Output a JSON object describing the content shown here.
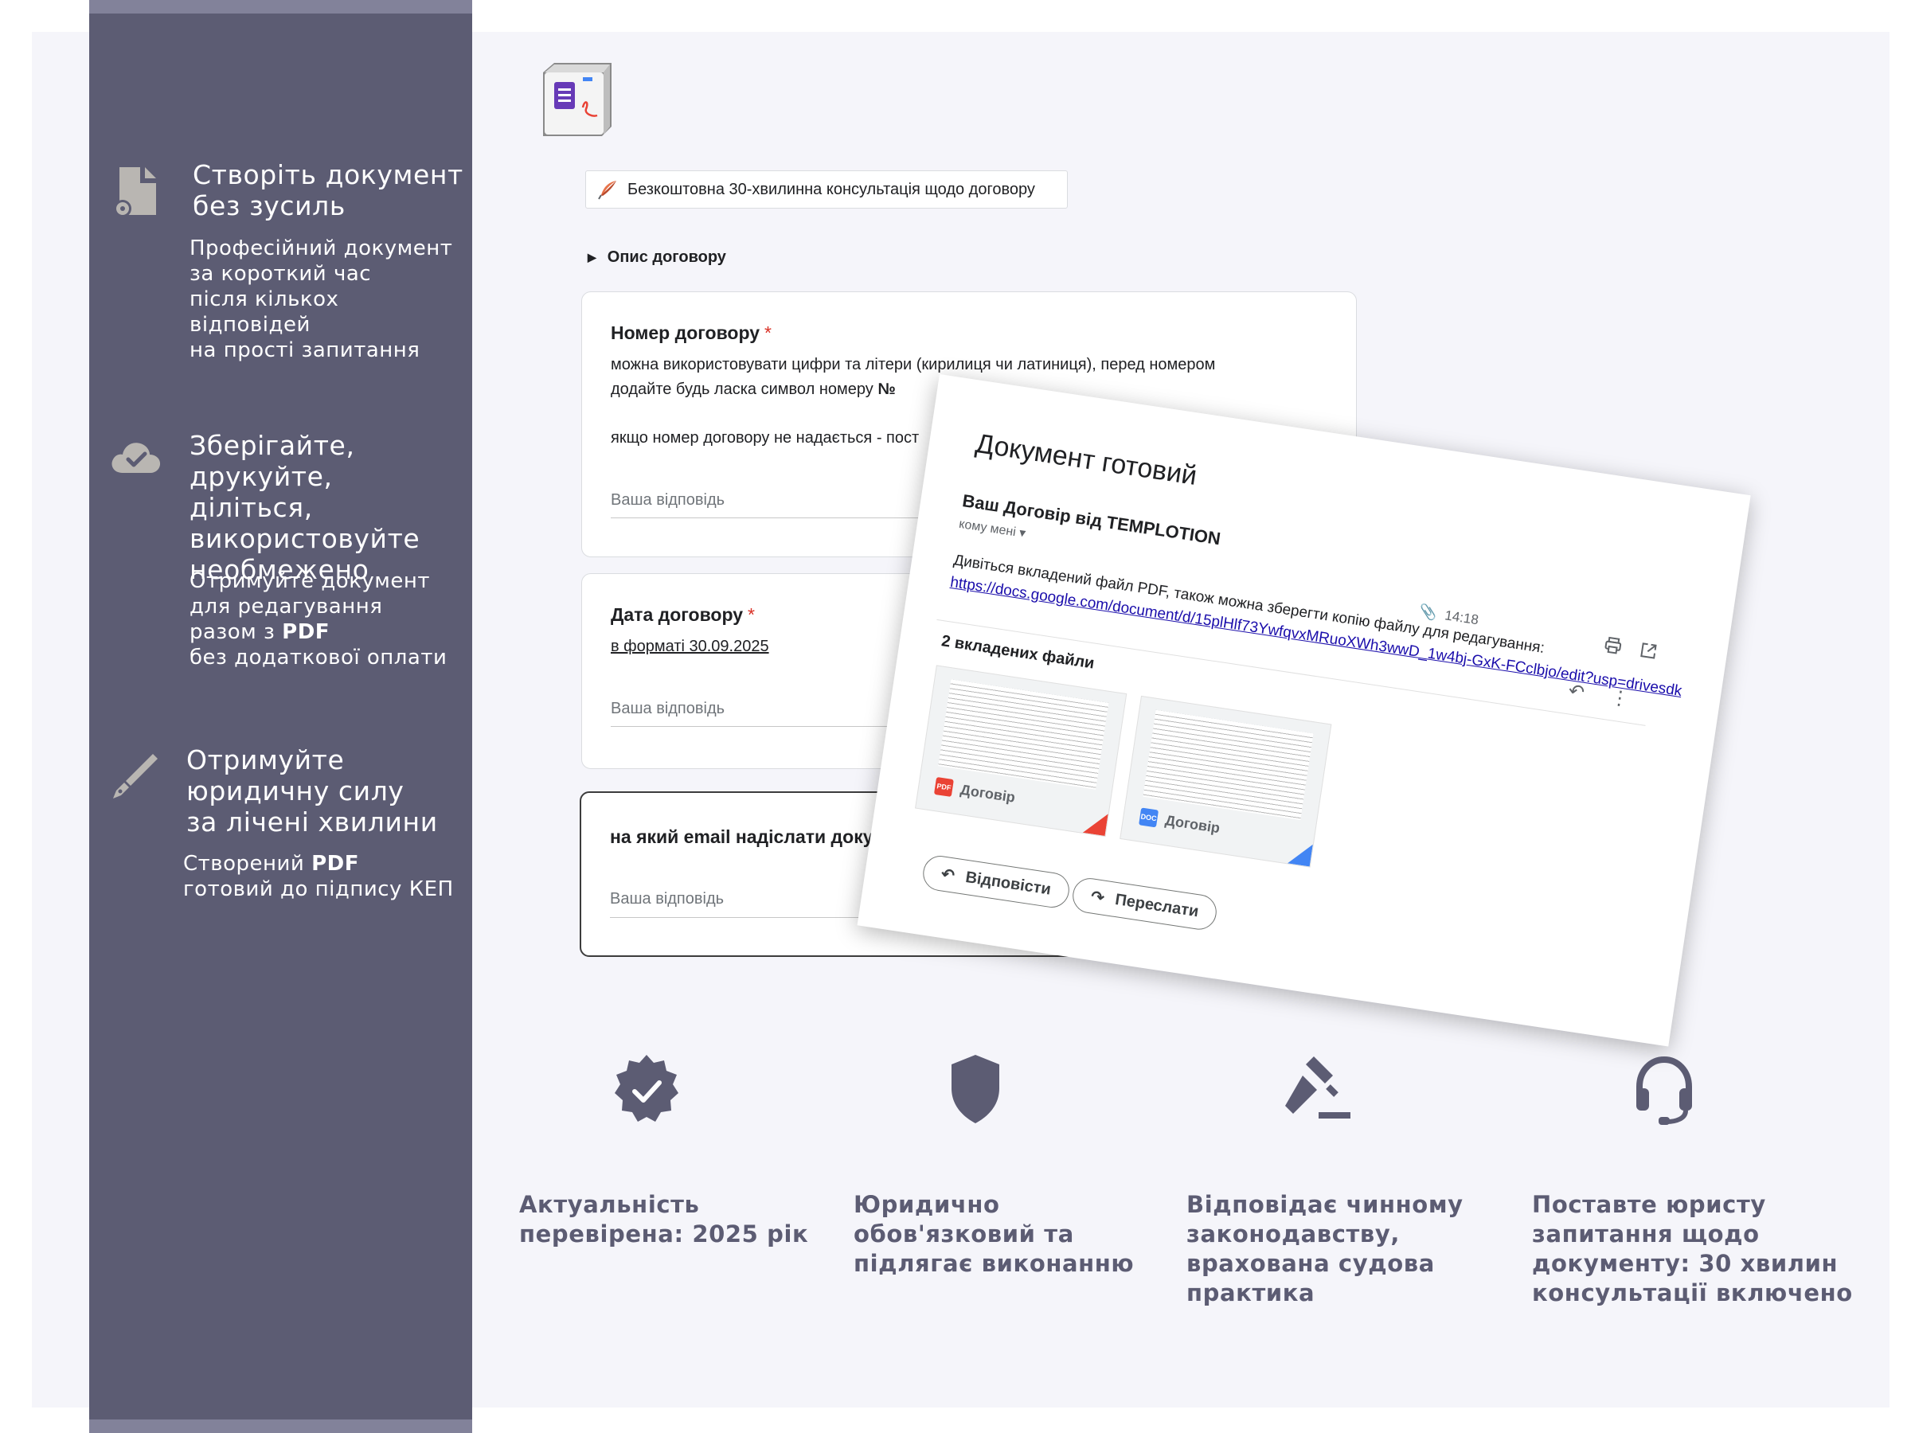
{
  "sidebar": {
    "features": [
      {
        "icon": "document-gear-icon",
        "title": "Створіть документ\nбез зусиль",
        "desc": "Професійний документ\nза короткий час\nпісля кількох відповідей\nна прості запитання"
      },
      {
        "icon": "cloud-check-icon",
        "title": "Зберігайте,\nдрукуйте, діліться,\nвикористовуйте\nнеобмежено",
        "desc_pre": "Отримуйте документ\nдля редагування\nразом з ",
        "desc_bold": "PDF",
        "desc_post": "\nбез додаткової оплати"
      },
      {
        "icon": "pen-nib-icon",
        "title": "Отримуйте\nюридичну силу\nза лічені хвилини",
        "desc_pre": "Створений ",
        "desc_bold": "PDF",
        "desc_post": "\nготовий до підпису КЕП"
      }
    ]
  },
  "header": {
    "logo_icon": "forms-pdf-logo-icon",
    "consult_button": "Безкоштовна 30-хвилинна консультація щодо договору",
    "description_toggle": "Опис договору"
  },
  "form": {
    "questions": [
      {
        "title": "Номер договору",
        "required": "*",
        "help_line1": "можна використовувати цифри та літери (кирилиця чи латиниця), перед номером",
        "help_line2": "додайте будь ласка символ номеру ",
        "help_symbol": "№",
        "help_line3": "якщо номер договору не надається - пост",
        "answer_placeholder": "Ваша відповідь"
      },
      {
        "title": "Дата договору",
        "required": "*",
        "help_line1": "в форматі 30.09.2025",
        "answer_placeholder": "Ваша відповідь"
      },
      {
        "title": "на який email надіслати доку",
        "answer_placeholder": "Ваша відповідь"
      }
    ]
  },
  "email_preview": {
    "heading": "Документ готовий",
    "subject": "Ваш Договір від TEMPLOTION",
    "to": "кому мені ▾",
    "time": "14:18",
    "body": "Дивіться вкладений файл PDF, також можна зберегти копію файлу для редагування:",
    "link": "https://docs.google.com/document/d/15plHlf73YwfqvxMRuoXWh3wwD_1w4bj-GxK-FCclbjo/edit?usp=drivesdk",
    "attachments_count": "2 вкладених файли",
    "attachments": [
      {
        "label": "Договір",
        "type": "PDF",
        "color": "#ea4335"
      },
      {
        "label": "Договір",
        "type": "DOC",
        "color": "#4285f4"
      }
    ],
    "reply_button": "Відповісти",
    "forward_button": "Переслати"
  },
  "advantages": [
    {
      "icon": "verified-badge-icon",
      "text": "Актуальність\nперевірена: 2025 рік"
    },
    {
      "icon": "shield-icon",
      "text": "Юридично\nобов'язковий та\nпідлягає виконанню"
    },
    {
      "icon": "gavel-icon",
      "text": "Відповідає чинному\nзаконодавству,\nврахована судова\nпрактика"
    },
    {
      "icon": "headset-icon",
      "text": "Поставте юристу\nзапитання щодо\nдокументу: 30 хвилин\nконсультації включено"
    }
  ],
  "colors": {
    "sidebar": "#5c5c73",
    "accent_required": "#d93025",
    "link": "#1a0dab",
    "icon_gray": "#b9b6b2"
  }
}
